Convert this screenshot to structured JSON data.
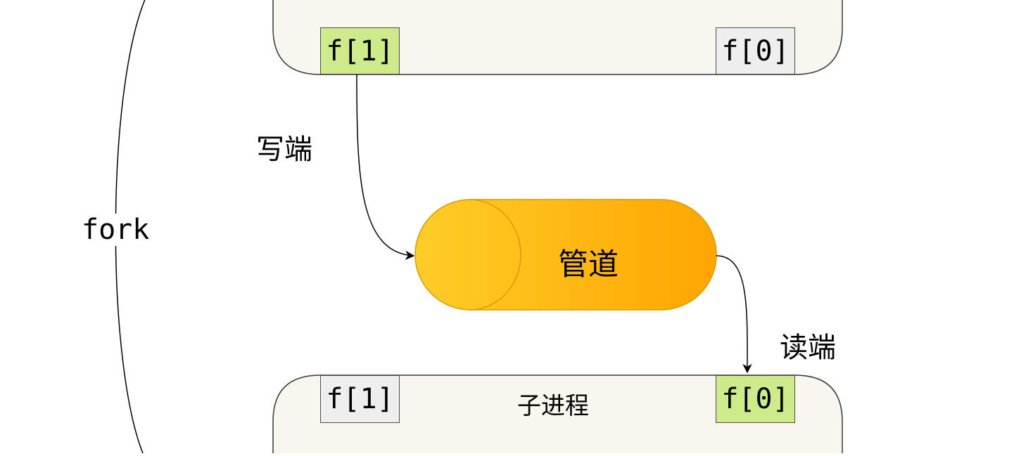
{
  "colors": {
    "process_fill": "#f9f7ed",
    "process_stroke": "#36393d",
    "fd_active_fill": "#cdeb8b",
    "fd_idle_fill": "#eeeeee",
    "pipe_gradient_start": "#ffcd28",
    "pipe_gradient_end": "#ffa500",
    "pipe_stroke": "#d79b00",
    "arrow": "#000000"
  },
  "parent_process": {
    "fd_write": "f[1]",
    "fd_read": "f[0]"
  },
  "child_process": {
    "title": "子进程",
    "fd_write": "f[1]",
    "fd_read": "f[0]"
  },
  "pipe": {
    "label": "管道"
  },
  "edges": {
    "write_label": "写端",
    "read_label": "读端",
    "fork_label": "fork"
  }
}
